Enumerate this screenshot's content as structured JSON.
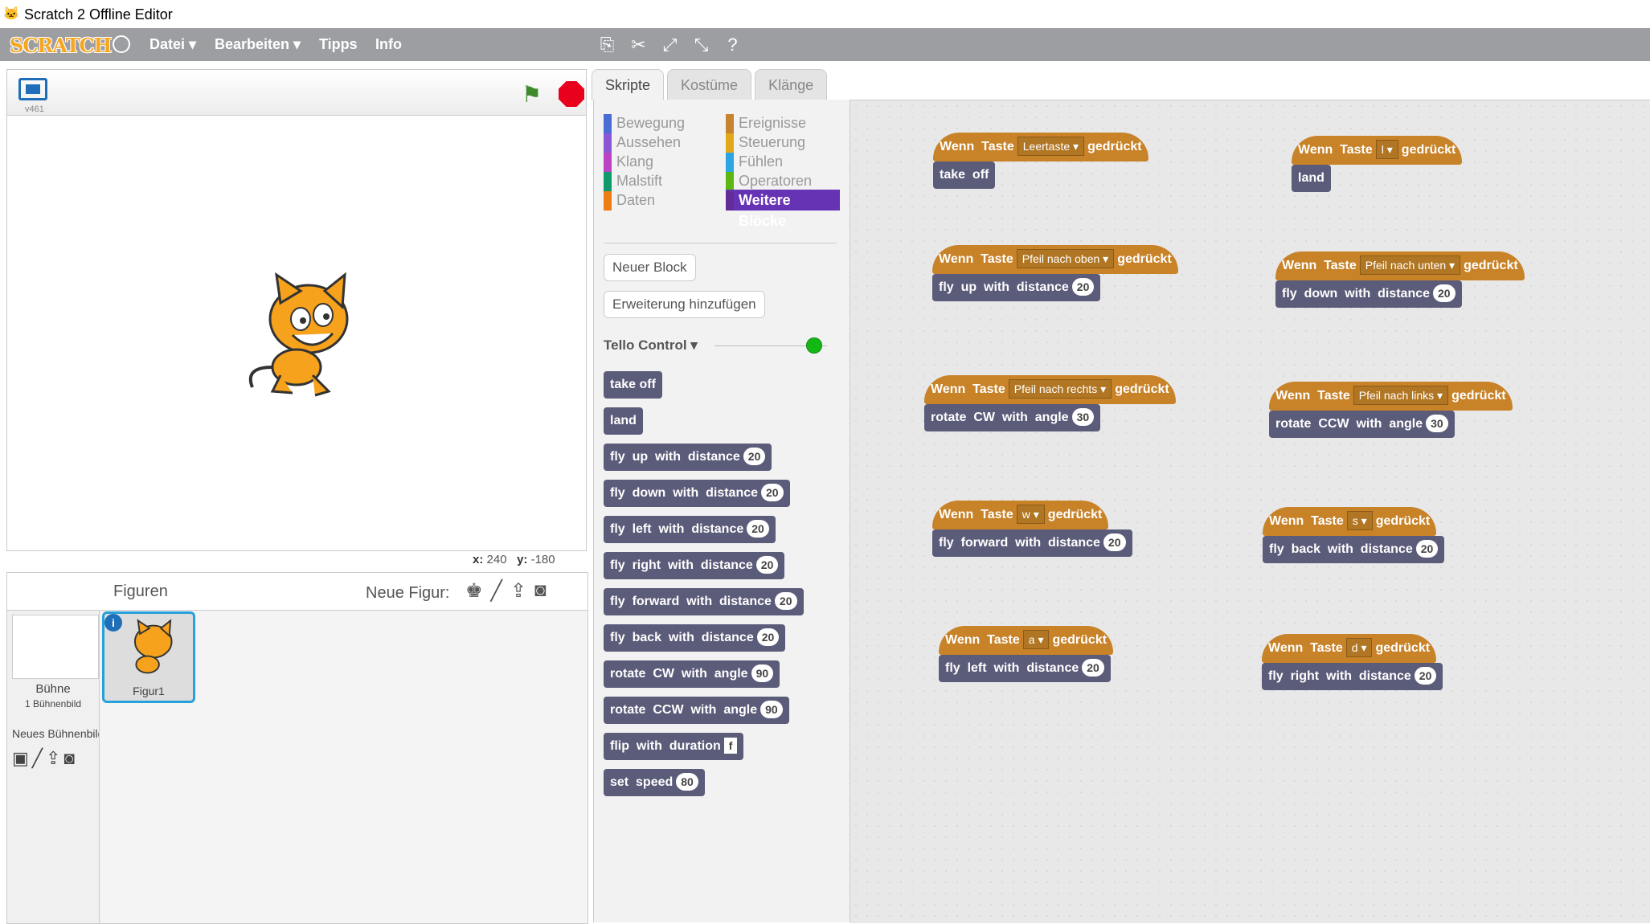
{
  "window": {
    "title": "Scratch 2 Offline Editor"
  },
  "menu": {
    "logo": "SCRATCH",
    "items": [
      "Datei ▾",
      "Bearbeiten ▾",
      "Tipps",
      "Info"
    ]
  },
  "stage": {
    "version": "v461",
    "coords_x_label": "x:",
    "coords_x": "240",
    "coords_y_label": "y:",
    "coords_y": "-180"
  },
  "sprites": {
    "header": "Figuren",
    "new_sprite": "Neue Figur:",
    "stage_label": "Bühne",
    "stage_count": "1 Bühnenbild",
    "new_backdrop": "Neues Bühnenbild:",
    "sprite_name": "Figur1",
    "info": "i"
  },
  "tabs": [
    "Skripte",
    "Kostüme",
    "Klänge"
  ],
  "categories": [
    {
      "label": "Bewegung",
      "color": "#4a6cd4"
    },
    {
      "label": "Aussehen",
      "color": "#8a55d7"
    },
    {
      "label": "Klang",
      "color": "#bb42c3"
    },
    {
      "label": "Malstift",
      "color": "#0e9a6c"
    },
    {
      "label": "Daten",
      "color": "#ee7d16"
    },
    {
      "label": "Ereignisse",
      "color": "#c88330"
    },
    {
      "label": "Steuerung",
      "color": "#e1a91a"
    },
    {
      "label": "Fühlen",
      "color": "#2ca5e2"
    },
    {
      "label": "Operatoren",
      "color": "#5cb712"
    },
    {
      "label": "Weitere Blöcke",
      "color": "#632d99"
    }
  ],
  "palette": {
    "new_block": "Neuer Block",
    "add_extension": "Erweiterung hinzufügen",
    "extension_name": "Tello Control ▾",
    "blocks": [
      {
        "text": "take off",
        "num": ""
      },
      {
        "text": "land",
        "num": ""
      },
      {
        "text": "fly  up  with  distance",
        "num": "20"
      },
      {
        "text": "fly  down  with  distance",
        "num": "20"
      },
      {
        "text": "fly  left  with  distance",
        "num": "20"
      },
      {
        "text": "fly  right  with  distance",
        "num": "20"
      },
      {
        "text": "fly  forward  with  distance",
        "num": "20"
      },
      {
        "text": "fly  back  with  distance",
        "num": "20"
      },
      {
        "text": "rotate  CW  with  angle",
        "num": "90"
      },
      {
        "text": "rotate  CCW  with  angle",
        "num": "90"
      },
      {
        "text": "flip  with  duration",
        "num": "f"
      },
      {
        "text": "set  speed",
        "num": "80"
      }
    ]
  },
  "scripts": [
    {
      "hat_pre": "Wenn  Taste",
      "key": "Leertaste ▾",
      "hat_post": "gedrückt",
      "cmd": "take  off",
      "num": ""
    },
    {
      "hat_pre": "Wenn  Taste",
      "key": "l ▾",
      "hat_post": "gedrückt",
      "cmd": "land",
      "num": ""
    },
    {
      "hat_pre": "Wenn  Taste",
      "key": "Pfeil nach oben ▾",
      "hat_post": "gedrückt",
      "cmd": "fly  up  with  distance",
      "num": "20"
    },
    {
      "hat_pre": "Wenn  Taste",
      "key": "Pfeil nach unten ▾",
      "hat_post": "gedrückt",
      "cmd": "fly  down  with  distance",
      "num": "20"
    },
    {
      "hat_pre": "Wenn  Taste",
      "key": "Pfeil nach rechts ▾",
      "hat_post": "gedrückt",
      "cmd": "rotate  CW  with  angle",
      "num": "30"
    },
    {
      "hat_pre": "Wenn  Taste",
      "key": "Pfeil nach links ▾",
      "hat_post": "gedrückt",
      "cmd": "rotate  CCW  with  angle",
      "num": "30"
    },
    {
      "hat_pre": "Wenn  Taste",
      "key": "w ▾",
      "hat_post": "gedrückt",
      "cmd": "fly  forward  with  distance",
      "num": "20"
    },
    {
      "hat_pre": "Wenn  Taste",
      "key": "s ▾",
      "hat_post": "gedrückt",
      "cmd": "fly  back  with  distance",
      "num": "20"
    },
    {
      "hat_pre": "Wenn  Taste",
      "key": "a ▾",
      "hat_post": "gedrückt",
      "cmd": "fly  left  with  distance",
      "num": "20"
    },
    {
      "hat_pre": "Wenn  Taste",
      "key": "d ▾",
      "hat_post": "gedrückt",
      "cmd": "fly  right  with  distance",
      "num": "20"
    }
  ]
}
